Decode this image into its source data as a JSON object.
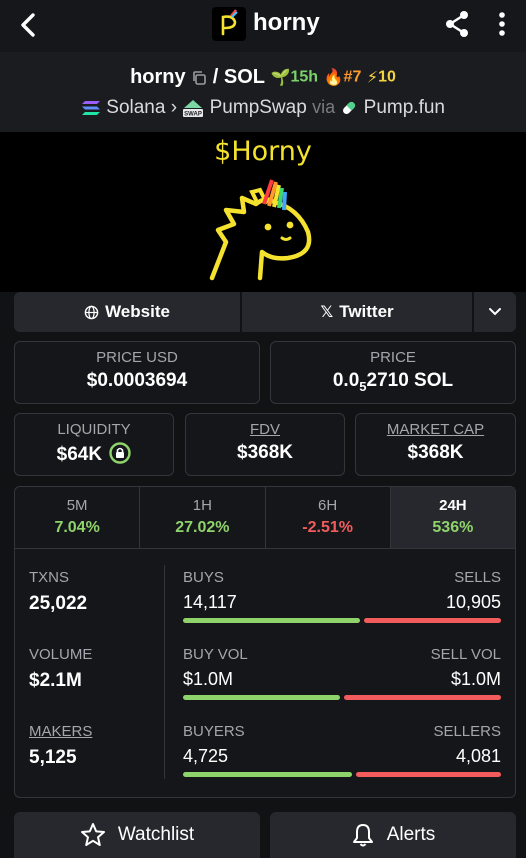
{
  "header": {
    "title": "horny",
    "logo_letter": "P"
  },
  "pair": {
    "base": "horny",
    "separator": "/",
    "quote": "SOL",
    "age": "15h",
    "rank": "#7",
    "boosts": "10",
    "chain": "Solana",
    "dex": "PumpSwap",
    "via_label": "via",
    "launchpad": "Pump.fun",
    "dex_badge": "SWAP"
  },
  "banner": {
    "title": "$Horny"
  },
  "links": {
    "website": "Website",
    "twitter": "Twitter"
  },
  "prices": {
    "price_usd_label": "PRICE USD",
    "price_usd": "$0.0003694",
    "price_label": "PRICE",
    "price_prefix": "0.0",
    "price_zeros": "5",
    "price_suffix": "2710 SOL"
  },
  "metrics": {
    "liquidity_label": "LIQUIDITY",
    "liquidity": "$64K",
    "fdv_label": "FDV",
    "fdv": "$368K",
    "mcap_label": "MARKET CAP",
    "mcap": "$368K"
  },
  "timeframes": [
    {
      "label": "5M",
      "change": "7.04%"
    },
    {
      "label": "1H",
      "change": "27.02%"
    },
    {
      "label": "6H",
      "change": "-2.51%"
    },
    {
      "label": "24H",
      "change": "536%"
    }
  ],
  "stats": {
    "txns_label": "TXNS",
    "txns": "25,022",
    "buys_label": "BUYS",
    "buys": "14,117",
    "sells_label": "SELLS",
    "sells": "10,905",
    "buys_share": 0.564,
    "volume_label": "VOLUME",
    "volume": "$2.1M",
    "buy_vol_label": "BUY VOL",
    "buy_vol": "$1.0M",
    "sell_vol_label": "SELL VOL",
    "sell_vol": "$1.0M",
    "buy_vol_share": 0.5,
    "makers_label": "MAKERS",
    "makers": "5,125",
    "buyers_label": "BUYERS",
    "buyers": "4,725",
    "sellers_label": "SELLERS",
    "sellers": "4,081",
    "buyers_share": 0.537
  },
  "actions": {
    "watchlist": "Watchlist",
    "alerts": "Alerts"
  },
  "colors": {
    "positive": "#8fd36b",
    "negative": "#f25c5c",
    "banner_yellow": "#f4e22e"
  }
}
